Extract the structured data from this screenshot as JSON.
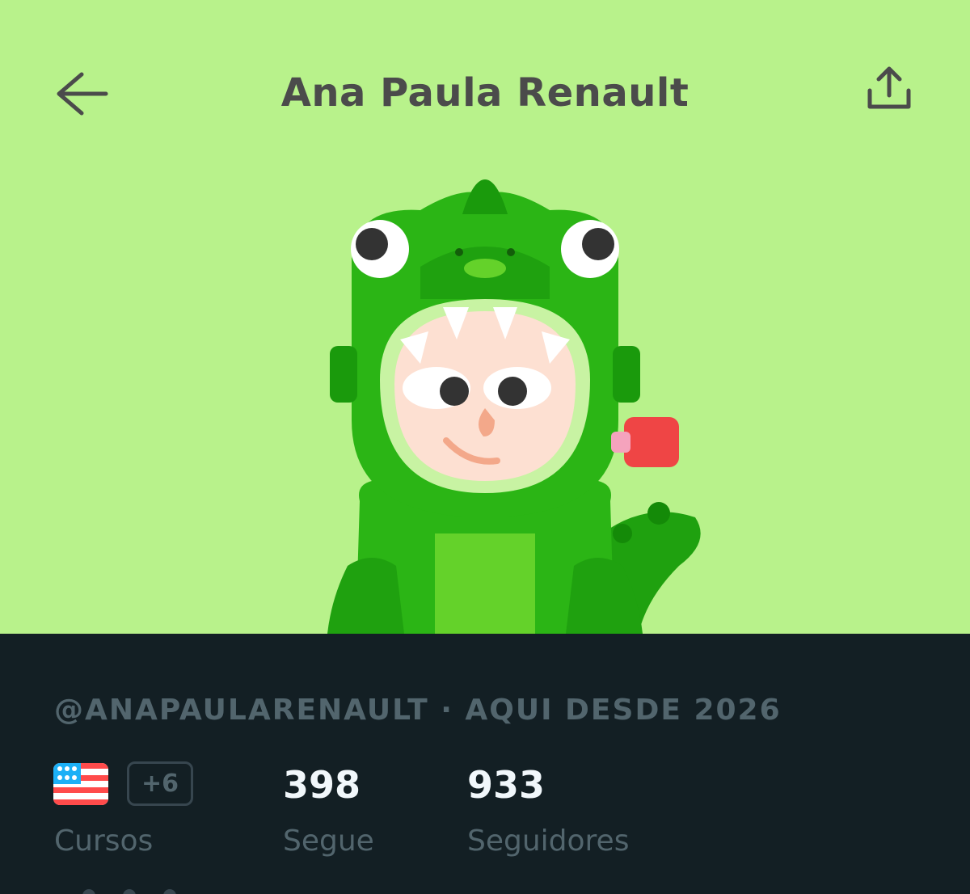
{
  "header": {
    "title": "Ana Paula Renault",
    "back_icon": "arrow-left-icon",
    "share_icon": "share-upload-icon"
  },
  "hero": {
    "background_color": "#b8f28b",
    "avatar": "avatar-in-green-dinosaur-costume"
  },
  "profile": {
    "username_line": "@ANAPAULARENAULT · AQUI DESDE 2026",
    "courses": {
      "flag_icon": "us-flag-icon",
      "more_badge": "+6",
      "label": "Cursos"
    },
    "following": {
      "value": "398",
      "label": "Segue"
    },
    "followers": {
      "value": "933",
      "label": "Seguidores"
    }
  },
  "colors": {
    "panel_bg": "#131f24",
    "muted_text": "#52656d",
    "bright_text": "#f1f7fb",
    "title_text": "#4b4b4b"
  }
}
